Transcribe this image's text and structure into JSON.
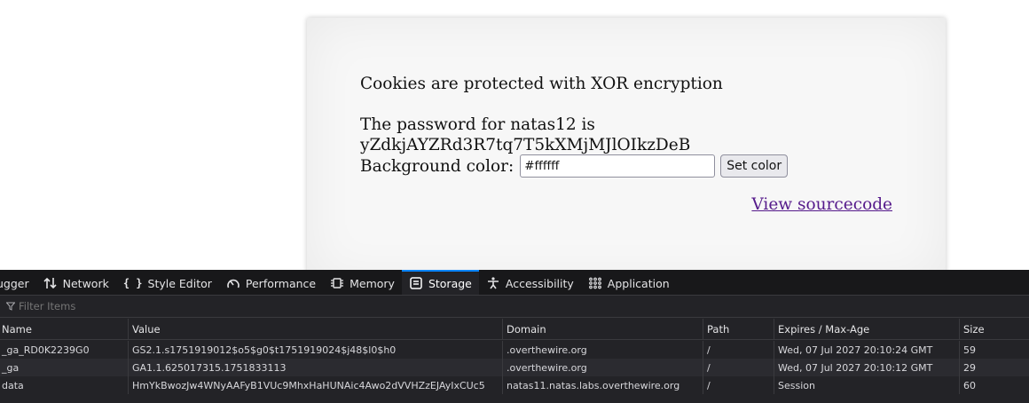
{
  "page": {
    "heading": "Cookies are protected with XOR encryption",
    "password_line1": "The password for natas12 is",
    "password_line2": "yZdkjAYZRd3R7tq7T5kXMjMJlOIkzDeB",
    "bg_label": "Background color:",
    "bg_value": "#ffffff",
    "set_color_label": "Set color",
    "source_link": "View sourcecode"
  },
  "devtools": {
    "tabs": [
      {
        "label": "ugger",
        "icon": "debugger-icon"
      },
      {
        "label": "Network",
        "icon": "network-arrows-icon"
      },
      {
        "label": "Style Editor",
        "icon": "style-editor-braces-icon",
        "glyph": "{ }"
      },
      {
        "label": "Performance",
        "icon": "performance-gauge-icon"
      },
      {
        "label": "Memory",
        "icon": "memory-chip-icon"
      },
      {
        "label": "Storage",
        "icon": "storage-icon",
        "selected": true
      },
      {
        "label": "Accessibility",
        "icon": "accessibility-person-icon"
      },
      {
        "label": "Application",
        "icon": "application-grid-icon"
      }
    ],
    "filter_placeholder": "Filter Items",
    "columns": [
      "Name",
      "Value",
      "Domain",
      "Path",
      "Expires / Max-Age",
      "Size"
    ],
    "rows": [
      {
        "name": "_ga_RD0K2239G0",
        "value": "GS2.1.s1751919012$o5$g0$t1751919024$j48$l0$h0",
        "domain": ".overthewire.org",
        "path": "/",
        "expires": "Wed, 07 Jul 2027 20:10:24 GMT",
        "size": "59"
      },
      {
        "name": "_ga",
        "value": "GA1.1.625017315.1751833113",
        "domain": ".overthewire.org",
        "path": "/",
        "expires": "Wed, 07 Jul 2027 20:10:12 GMT",
        "size": "29"
      },
      {
        "name": "data",
        "value": "HmYkBwozJw4WNyAAFyB1VUc9MhxHaHUNAic4Awo2dVVHZzEJAyIxCUc5",
        "domain": "natas11.natas.labs.overthewire.org",
        "path": "/",
        "expires": "Session",
        "size": "60"
      }
    ],
    "colors": {
      "accent": "#0a84ff",
      "panel": "#232327",
      "tabbar": "#18181a"
    }
  }
}
